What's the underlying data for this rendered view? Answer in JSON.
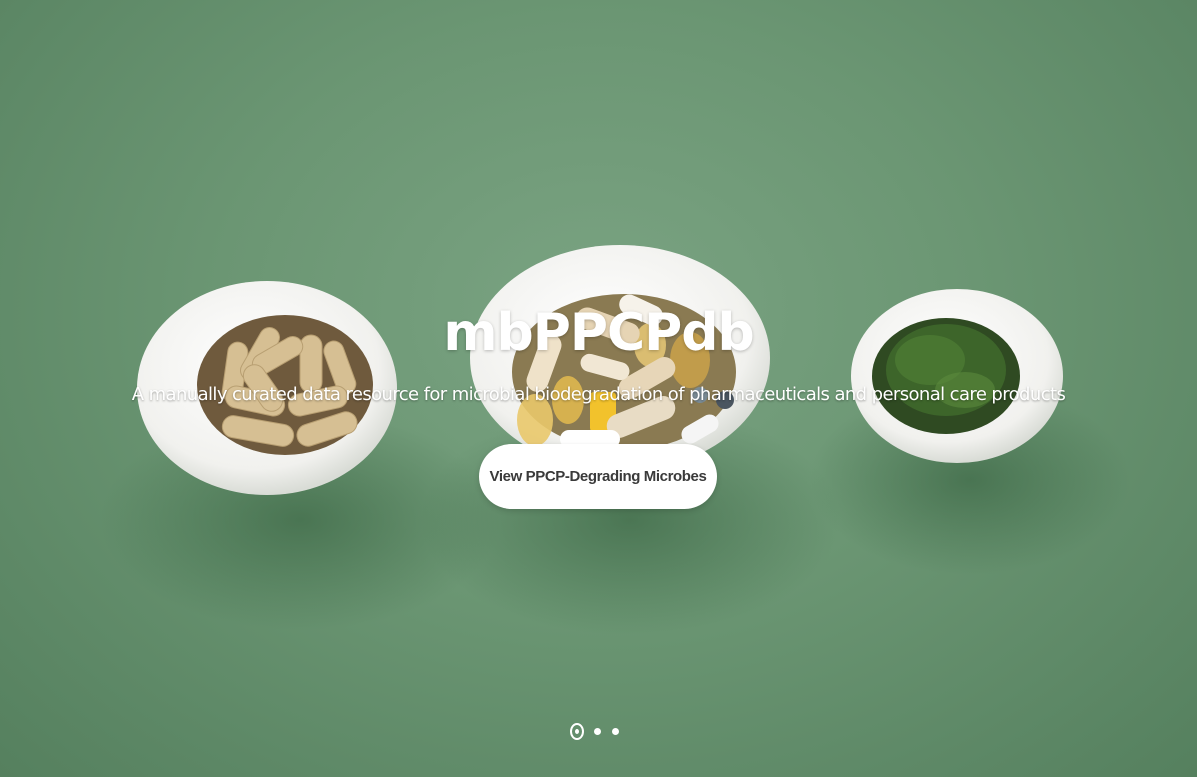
{
  "hero": {
    "title": "mbPPCPdb",
    "tagline": "A manually curated data resource for microbial biodegradation of pharmaceuticals and personal care products",
    "cta_label": "View PPCP-Degrading Microbes",
    "background_image": "bowls-of-capsules-pills-and-dried-herbs",
    "colors": {
      "background": "#6b9673",
      "text": "#ffffff",
      "button_bg": "#ffffff",
      "button_text": "#3a3a3a"
    }
  },
  "carousel": {
    "slide_count": 3,
    "active_index": 0
  }
}
